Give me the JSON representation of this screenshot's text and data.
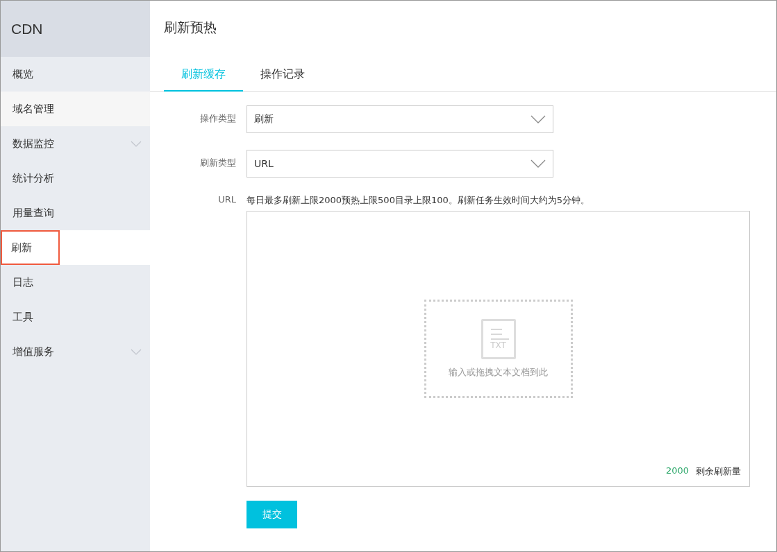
{
  "sidebar": {
    "title": "CDN",
    "items": [
      {
        "label": "概览",
        "selected": false,
        "hovered": false,
        "expandable": false,
        "highlighted": false
      },
      {
        "label": "域名管理",
        "selected": false,
        "hovered": true,
        "expandable": false,
        "highlighted": false
      },
      {
        "label": "数据监控",
        "selected": false,
        "hovered": false,
        "expandable": true,
        "highlighted": false
      },
      {
        "label": "统计分析",
        "selected": false,
        "hovered": false,
        "expandable": false,
        "highlighted": false
      },
      {
        "label": "用量查询",
        "selected": false,
        "hovered": false,
        "expandable": false,
        "highlighted": false
      },
      {
        "label": "刷新",
        "selected": true,
        "hovered": false,
        "expandable": false,
        "highlighted": true
      },
      {
        "label": "日志",
        "selected": false,
        "hovered": false,
        "expandable": false,
        "highlighted": false
      },
      {
        "label": "工具",
        "selected": false,
        "hovered": false,
        "expandable": false,
        "highlighted": false
      },
      {
        "label": "增值服务",
        "selected": false,
        "hovered": false,
        "expandable": true,
        "highlighted": false
      }
    ]
  },
  "page": {
    "title": "刷新预热"
  },
  "tabs": [
    {
      "label": "刷新缓存",
      "selected": true
    },
    {
      "label": "操作记录",
      "selected": false
    }
  ],
  "form": {
    "fields": [
      {
        "label": "操作类型",
        "value": "刷新"
      },
      {
        "label": "刷新类型",
        "value": "URL"
      }
    ],
    "url_label": "URL",
    "hint": "每日最多刷新上限2000预热上限500目录上限100。刷新任务生效时间大约为5分钟。",
    "drop_zone": {
      "icon_text": "TXT",
      "text": "输入或拖拽文本文档到此"
    },
    "remaining_count": "2000",
    "remaining_label": "剩余刷新量",
    "submit": "提交"
  }
}
